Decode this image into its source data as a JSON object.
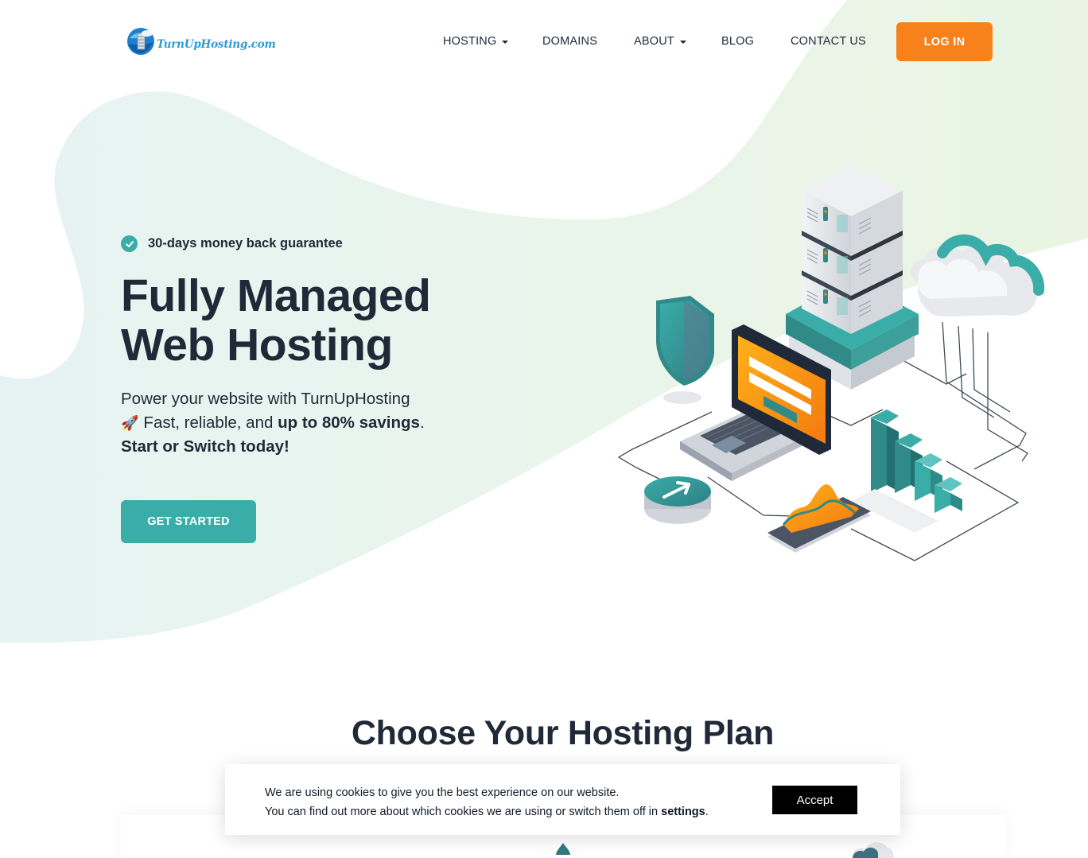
{
  "brand": {
    "logo_text": "TurnUpHosting.com"
  },
  "nav": {
    "hosting": "HOSTING",
    "domains": "DOMAINS",
    "about": "ABOUT",
    "blog": "BLOG",
    "contact": "CONTACT US",
    "login": "LOG IN"
  },
  "hero": {
    "guarantee": "30-days money back guarantee",
    "title_line1": "Fully Managed",
    "title_line2": "Web Hosting",
    "desc_part1": "Power your website with TurnUpHosting",
    "rocket": "🚀",
    "desc_part2": "Fast, reliable, and",
    "desc_bold": "up to 80% savings",
    "desc_period": ".",
    "desc_cta": "Start or Switch today!",
    "cta_button": "GET STARTED"
  },
  "plans": {
    "title": "Choose Your Hosting Plan"
  },
  "cookie": {
    "line1": "We are using cookies to give you the best experience on our website.",
    "line2_prefix": "You can find out more about which cookies we are using or switch them off in",
    "settings_link": "settings",
    "line2_suffix": ".",
    "accept": "Accept"
  },
  "colors": {
    "accent_teal": "#3aada8",
    "accent_orange": "#f7821b",
    "text_dark": "#1f2937",
    "blob_green": "#e9f5e8"
  },
  "icons": [
    "check-circle-icon",
    "caret-down-icon",
    "rocket-icon",
    "globe-logo-icon"
  ]
}
